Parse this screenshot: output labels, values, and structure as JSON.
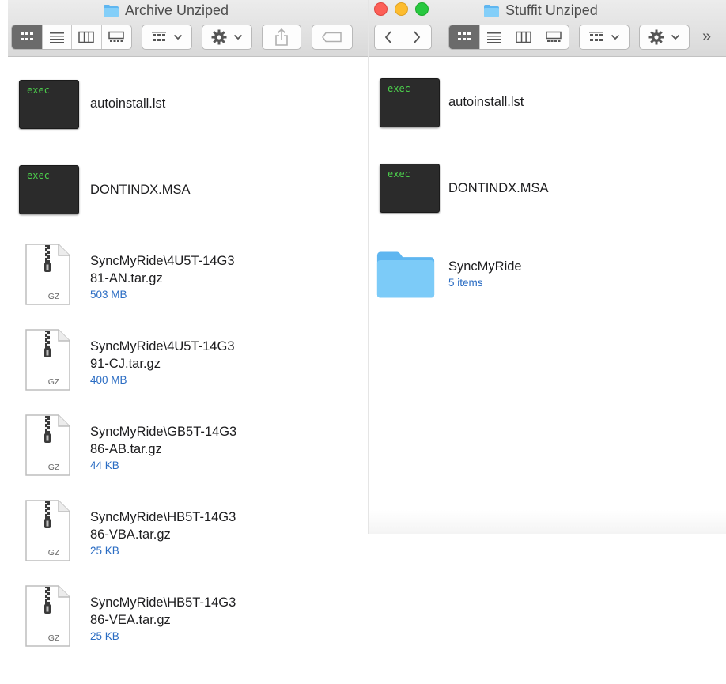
{
  "colors": {
    "toolbar_bg": "#e3e3e3",
    "active_view": "#6b6b6b",
    "meta_text": "#2a6cc3",
    "folder_blue": "#6fc3f7",
    "exec_green": "#4ccf4c"
  },
  "left_window": {
    "title": "Archive Unziped",
    "title_icon": "folder-icon",
    "toolbar": {
      "view_modes": [
        "icon-view-icon",
        "list-view-icon",
        "column-view-icon",
        "gallery-view-icon"
      ],
      "active_view": "icon-view-icon",
      "group_menu_icon": "group-by-icon",
      "action_menu_icon": "gear-icon",
      "share_icon": "share-icon",
      "tag_icon": "tag-icon"
    },
    "files": [
      {
        "kind": "exec",
        "icon_label": "exec",
        "name_lines": [
          "autoinstall.lst"
        ],
        "meta": ""
      },
      {
        "kind": "exec",
        "icon_label": "exec",
        "name_lines": [
          "DONTINDX.MSA"
        ],
        "meta": ""
      },
      {
        "kind": "gz",
        "icon_label": "GZ",
        "name_lines": [
          "SyncMyRide\\4U5T-14G3",
          "81-AN.tar.gz"
        ],
        "meta": "503 MB"
      },
      {
        "kind": "gz",
        "icon_label": "GZ",
        "name_lines": [
          "SyncMyRide\\4U5T-14G3",
          "91-CJ.tar.gz"
        ],
        "meta": "400 MB"
      },
      {
        "kind": "gz",
        "icon_label": "GZ",
        "name_lines": [
          "SyncMyRide\\GB5T-14G3",
          "86-AB.tar.gz"
        ],
        "meta": "44 KB"
      },
      {
        "kind": "gz",
        "icon_label": "GZ",
        "name_lines": [
          "SyncMyRide\\HB5T-14G3",
          "86-VBA.tar.gz"
        ],
        "meta": "25 KB"
      },
      {
        "kind": "gz",
        "icon_label": "GZ",
        "name_lines": [
          "SyncMyRide\\HB5T-14G3",
          "86-VEA.tar.gz"
        ],
        "meta": "25 KB"
      }
    ]
  },
  "right_window": {
    "title": "Stuffit Unziped",
    "title_icon": "folder-icon",
    "toolbar": {
      "back_icon": "chevron-left-icon",
      "forward_icon": "chevron-right-icon",
      "view_modes": [
        "icon-view-icon",
        "list-view-icon",
        "column-view-icon",
        "gallery-view-icon"
      ],
      "active_view": "icon-view-icon",
      "group_menu_icon": "group-by-icon",
      "action_menu_icon": "gear-icon",
      "overflow_glyph": "»"
    },
    "files": [
      {
        "kind": "exec",
        "icon_label": "exec",
        "name_lines": [
          "autoinstall.lst"
        ],
        "meta": ""
      },
      {
        "kind": "exec",
        "icon_label": "exec",
        "name_lines": [
          "DONTINDX.MSA"
        ],
        "meta": ""
      },
      {
        "kind": "folder",
        "icon_label": "",
        "name_lines": [
          "SyncMyRide"
        ],
        "meta": "5 items"
      }
    ]
  }
}
